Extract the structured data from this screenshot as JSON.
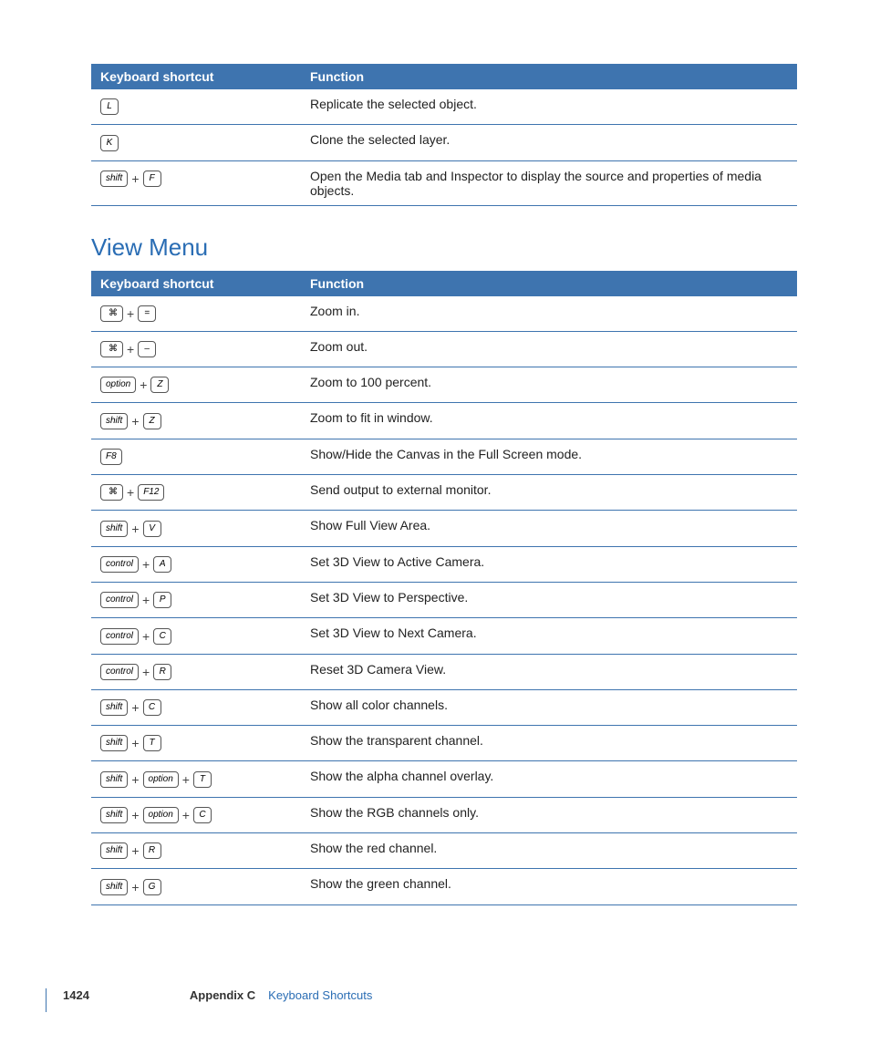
{
  "tables": {
    "top": {
      "headers": [
        "Keyboard shortcut",
        "Function"
      ],
      "rows": [
        {
          "keys": [
            {
              "type": "key",
              "label": "L"
            }
          ],
          "func": "Replicate the selected object."
        },
        {
          "keys": [
            {
              "type": "key",
              "label": "K"
            }
          ],
          "func": "Clone the selected layer."
        },
        {
          "keys": [
            {
              "type": "key",
              "label": "shift"
            },
            {
              "type": "plus"
            },
            {
              "type": "key",
              "label": "F"
            }
          ],
          "func": "Open the Media tab and Inspector to display the source and properties of media objects."
        }
      ]
    },
    "view": {
      "headers": [
        "Keyboard shortcut",
        "Function"
      ],
      "rows": [
        {
          "keys": [
            {
              "type": "cmdkey"
            },
            {
              "type": "plus"
            },
            {
              "type": "key",
              "label": "="
            }
          ],
          "func": "Zoom in."
        },
        {
          "keys": [
            {
              "type": "cmdkey"
            },
            {
              "type": "plus"
            },
            {
              "type": "key",
              "label": "–"
            }
          ],
          "func": "Zoom out."
        },
        {
          "keys": [
            {
              "type": "key",
              "label": "option"
            },
            {
              "type": "plus"
            },
            {
              "type": "key",
              "label": "Z"
            }
          ],
          "func": "Zoom to 100 percent."
        },
        {
          "keys": [
            {
              "type": "key",
              "label": "shift"
            },
            {
              "type": "plus"
            },
            {
              "type": "key",
              "label": "Z"
            }
          ],
          "func": "Zoom to fit in window."
        },
        {
          "keys": [
            {
              "type": "key",
              "label": "F8"
            }
          ],
          "func": "Show/Hide the Canvas in the Full Screen mode."
        },
        {
          "keys": [
            {
              "type": "cmdkey"
            },
            {
              "type": "plus"
            },
            {
              "type": "key",
              "label": "F12"
            }
          ],
          "func": "Send output to external monitor."
        },
        {
          "keys": [
            {
              "type": "key",
              "label": "shift"
            },
            {
              "type": "plus"
            },
            {
              "type": "key",
              "label": "V"
            }
          ],
          "func": "Show Full View Area."
        },
        {
          "keys": [
            {
              "type": "key",
              "label": "control"
            },
            {
              "type": "plus"
            },
            {
              "type": "key",
              "label": "A"
            }
          ],
          "func": "Set 3D View to Active Camera."
        },
        {
          "keys": [
            {
              "type": "key",
              "label": "control"
            },
            {
              "type": "plus"
            },
            {
              "type": "key",
              "label": "P"
            }
          ],
          "func": "Set 3D View to Perspective."
        },
        {
          "keys": [
            {
              "type": "key",
              "label": "control"
            },
            {
              "type": "plus"
            },
            {
              "type": "key",
              "label": "C"
            }
          ],
          "func": "Set 3D View to Next Camera."
        },
        {
          "keys": [
            {
              "type": "key",
              "label": "control"
            },
            {
              "type": "plus"
            },
            {
              "type": "key",
              "label": "R"
            }
          ],
          "func": "Reset 3D Camera View."
        },
        {
          "keys": [
            {
              "type": "key",
              "label": "shift"
            },
            {
              "type": "plus"
            },
            {
              "type": "key",
              "label": "C"
            }
          ],
          "func": "Show all color channels."
        },
        {
          "keys": [
            {
              "type": "key",
              "label": "shift"
            },
            {
              "type": "plus"
            },
            {
              "type": "key",
              "label": "T"
            }
          ],
          "func": "Show the transparent channel."
        },
        {
          "keys": [
            {
              "type": "key",
              "label": "shift"
            },
            {
              "type": "plus"
            },
            {
              "type": "key",
              "label": "option"
            },
            {
              "type": "plus"
            },
            {
              "type": "key",
              "label": "T"
            }
          ],
          "func": "Show the alpha channel overlay."
        },
        {
          "keys": [
            {
              "type": "key",
              "label": "shift"
            },
            {
              "type": "plus"
            },
            {
              "type": "key",
              "label": "option"
            },
            {
              "type": "plus"
            },
            {
              "type": "key",
              "label": "C"
            }
          ],
          "func": "Show the RGB channels only."
        },
        {
          "keys": [
            {
              "type": "key",
              "label": "shift"
            },
            {
              "type": "plus"
            },
            {
              "type": "key",
              "label": "R"
            }
          ],
          "func": "Show the red channel."
        },
        {
          "keys": [
            {
              "type": "key",
              "label": "shift"
            },
            {
              "type": "plus"
            },
            {
              "type": "key",
              "label": "G"
            }
          ],
          "func": "Show the green channel."
        }
      ]
    }
  },
  "section_title": "View Menu",
  "footer": {
    "page": "1424",
    "appendix": "Appendix C",
    "title": "Keyboard Shortcuts"
  }
}
